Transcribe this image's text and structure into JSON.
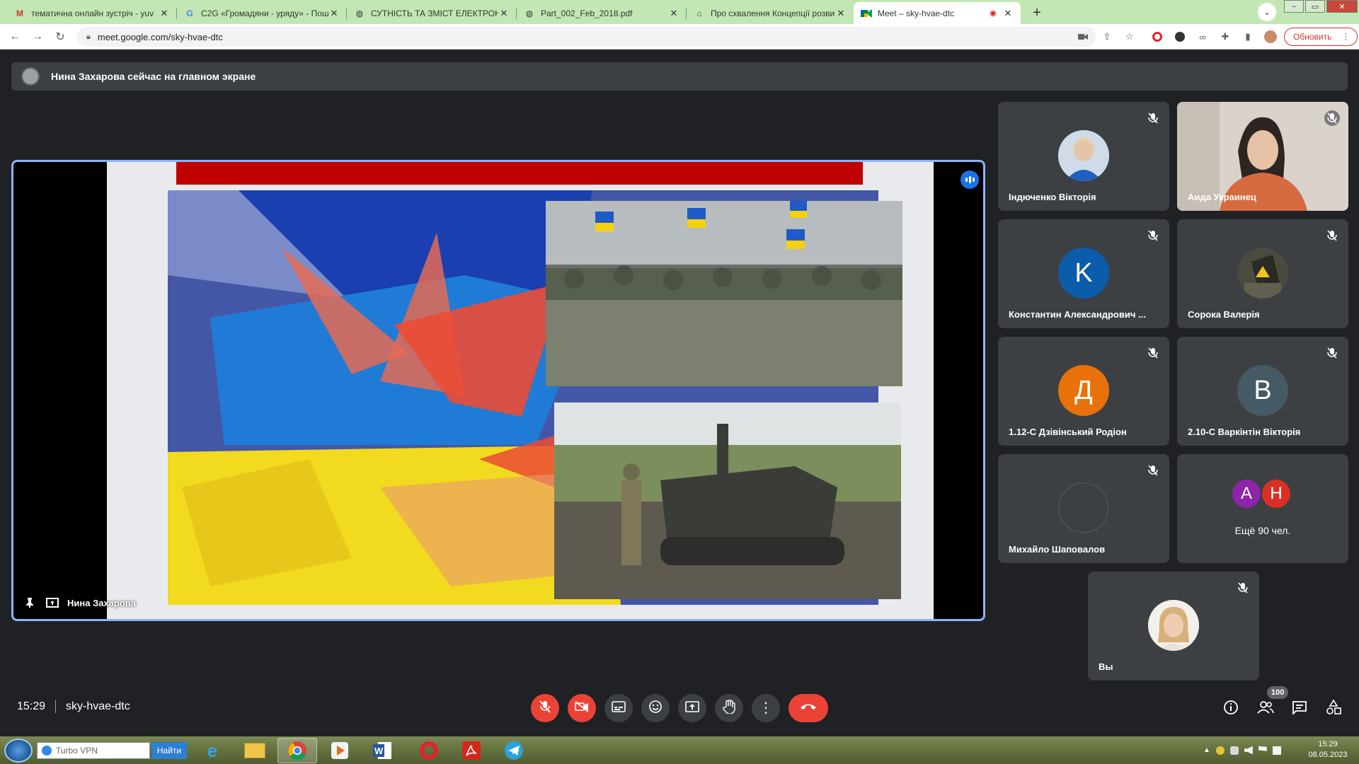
{
  "browser": {
    "tabs": [
      {
        "title": "тематична онлайн зустріч - yuv",
        "icon": "gmail-icon"
      },
      {
        "title": "C2G «Громадяни - уряду» - Пош",
        "icon": "google-icon"
      },
      {
        "title": "СУТНІСТЬ ТА ЗМІСТ ЕЛЕКТРОНН",
        "icon": "globe-icon"
      },
      {
        "title": "Part_002_Feb_2018.pdf",
        "icon": "globe-icon"
      },
      {
        "title": "Про схвалення Концепції розви",
        "icon": "building-icon"
      },
      {
        "title": "Meet – sky-hvae-dtc",
        "icon": "meet-icon",
        "active": true,
        "recording": true
      }
    ],
    "url": "meet.google.com/sky-hvae-dtc",
    "update_label": "Обновить"
  },
  "meet": {
    "banner": "Нина Захарова сейчас на главном экране",
    "presenter": "Нина Захарова",
    "participants": [
      {
        "name": "Індюченко Вікторія",
        "type": "photo",
        "muted": true,
        "color": "#a7c4dc"
      },
      {
        "name": "Аида Украинец",
        "type": "video",
        "muted": true
      },
      {
        "name": "Константин Александрович ...",
        "type": "letter",
        "letter": "K",
        "color": "#0b5cab",
        "muted": true
      },
      {
        "name": "Сорока Валерія",
        "type": "photo",
        "muted": true,
        "color": "#3b3a33"
      },
      {
        "name": "1.12-С Дзівінський Родіон",
        "type": "letter",
        "letter": "Д",
        "color": "#e8710a",
        "muted": true
      },
      {
        "name": "2.10-С Варкінтін Вікторія",
        "type": "letter",
        "letter": "B",
        "color": "#455a64",
        "muted": true
      },
      {
        "name": "Михайло Шаповалов",
        "type": "loading",
        "muted": true
      },
      {
        "name": "Вы",
        "type": "photo",
        "muted": true,
        "color": "#e2c6a0"
      }
    ],
    "others": {
      "letters": [
        "A",
        "H"
      ],
      "colors": [
        "#8e24aa",
        "#d93025"
      ],
      "label": "Ещё 90 чел."
    },
    "time": "15:29",
    "meeting_code": "sky-hvae-dtc",
    "people_count": "100"
  },
  "taskbar": {
    "search_placeholder": "Turbo VPN",
    "search_button": "Найти",
    "clock_time": "15:29",
    "clock_date": "08.05.2023"
  }
}
